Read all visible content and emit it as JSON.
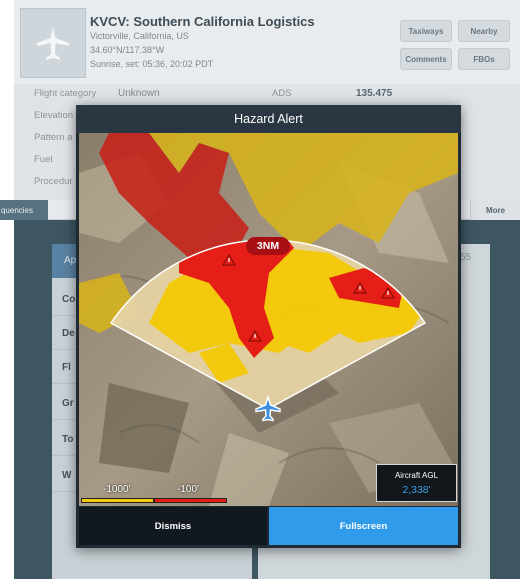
{
  "airport": {
    "title": "KVCV: Southern California Logistics",
    "location": "Victorville, California, US",
    "coordinates": "34.60°N/117.38°W",
    "sun_times": "Sunrise, set: 05:36, 20:02 PDT",
    "buttons": [
      "Taxiways",
      "Nearby",
      "Comments",
      "FBOs"
    ]
  },
  "info": {
    "flight_category_label": "Flight category",
    "flight_category_value": "Unknown",
    "ads_label": "ADS",
    "ads_value": "135.475",
    "row_labels": [
      "Elevation",
      "Pattern a",
      "Fuel",
      "Procedur"
    ]
  },
  "tabs": {
    "frequencies": "quencies",
    "more": "More"
  },
  "list": {
    "header": "Ap",
    "rows": [
      "Co",
      "De",
      "Fl",
      "Gr",
      "To",
      "W"
    ],
    "right_number": "55"
  },
  "modal": {
    "title": "Hazard Alert",
    "range_label": "3NM",
    "legend": {
      "low_label": "-1000'",
      "high_label": "-100'",
      "low_color": "#f2c90c",
      "high_color": "#e51f17"
    },
    "agl": {
      "label": "Aircraft AGL",
      "value": "2,338'"
    },
    "dismiss_label": "Dismiss",
    "fullscreen_label": "Fullscreen"
  },
  "icons": {
    "airport_thumb": "airplane-icon",
    "ownship": "ownship-airplane-icon",
    "hazard": "hazard-triangle-icon"
  },
  "colors": {
    "accent": "#2f9bea",
    "hazard_red": "#e51f17",
    "caution_yellow": "#f2c90c"
  }
}
